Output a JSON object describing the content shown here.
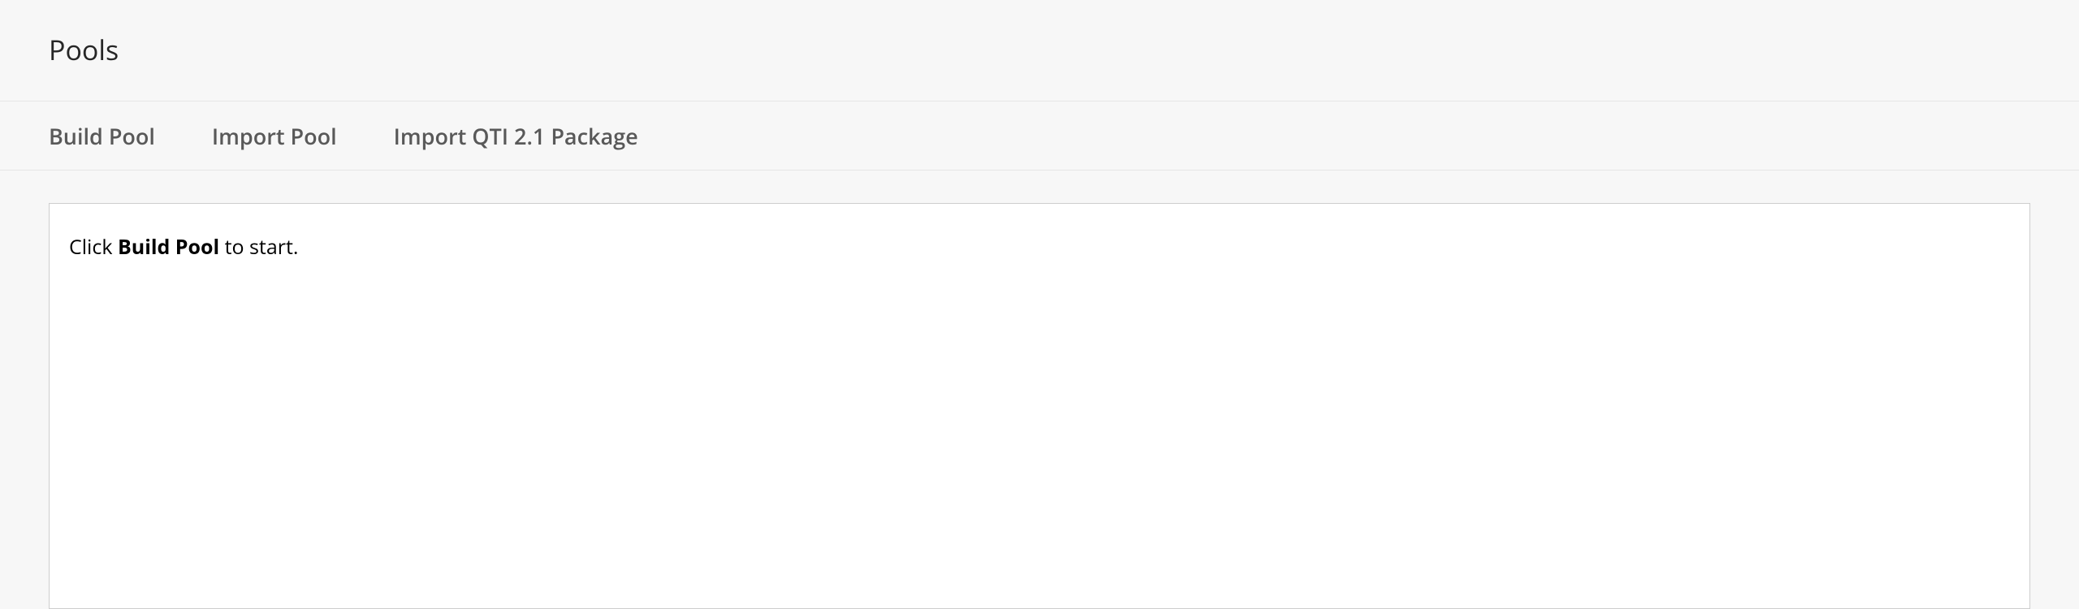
{
  "header": {
    "title": "Pools"
  },
  "toolbar": {
    "build_label": "Build Pool",
    "import_label": "Import Pool",
    "import_qti_label": "Import QTI 2.1 Package"
  },
  "content": {
    "instruction_prefix": "Click ",
    "instruction_bold": "Build Pool",
    "instruction_suffix": " to start."
  }
}
